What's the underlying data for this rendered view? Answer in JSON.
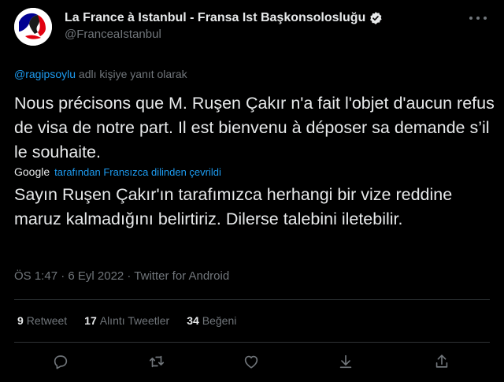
{
  "account": {
    "display_name": "La France à Istanbul - Fransa Ist Başkonsolosluğu",
    "handle": "@FranceaIstanbul"
  },
  "reply": {
    "mention": "@ragipsoylu",
    "suffix": "adlı kişiye yanıt olarak"
  },
  "tweet": {
    "original_text": "Nous précisons que M. Ruşen Çakır n'a fait l'objet d'aucun refus de visa de notre part. Il est bienvenu à déposer sa demande s’il le souhaite.",
    "translation_provider": "Google",
    "translation_note": "tarafından Fransızca dilinden çevrildi",
    "translated_text": "Sayın Ruşen Çakır'ın tarafımızca herhangi bir vize reddine maruz kalmadığını belirtiriz. Dilerse talebini iletebilir.",
    "meta": "ÖS 1:47 · 6 Eyl 2022 · Twitter for Android"
  },
  "stats": {
    "retweets_count": "9",
    "retweets_label": "Retweet",
    "quotes_count": "17",
    "quotes_label": "Alıntı Tweetler",
    "likes_count": "34",
    "likes_label": "Beğeni"
  },
  "icons": {
    "reply": "reply-icon",
    "retweet": "retweet-icon",
    "like": "heart-icon",
    "bookmark": "download-icon",
    "share": "share-icon"
  },
  "colors": {
    "background": "#000000",
    "text": "#e7e9ea",
    "muted": "#71767b",
    "accent": "#1d9bf0",
    "border": "#2f3336"
  }
}
